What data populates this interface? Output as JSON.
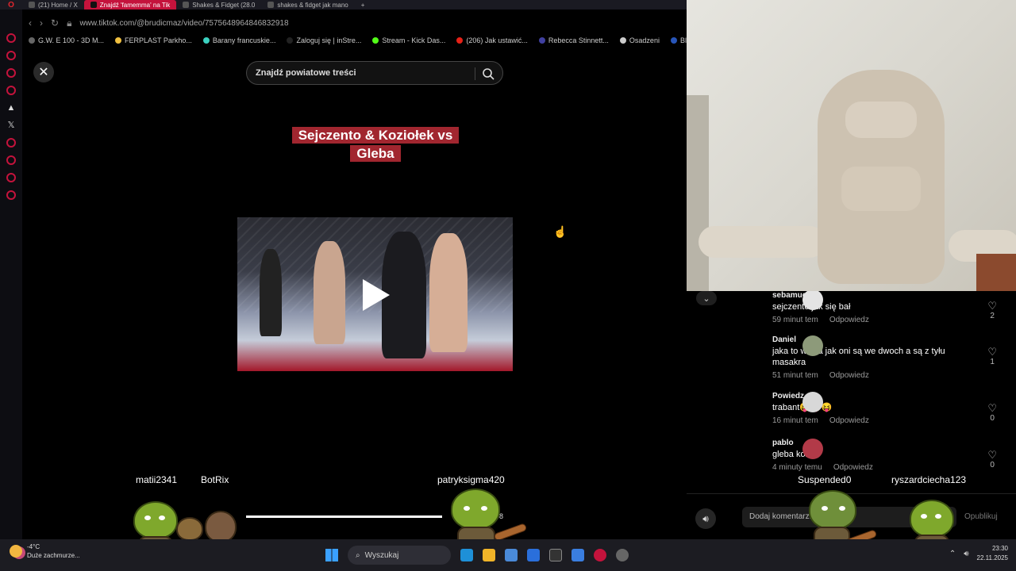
{
  "browser": {
    "tabs": [
      {
        "label": "(21) Home / X",
        "active": false
      },
      {
        "label": "Znajdź 'famemma' na Tik",
        "active": true
      },
      {
        "label": "Shakes & Fidget (28.0",
        "active": false
      },
      {
        "label": "shakes & fidget jak mano",
        "active": false
      }
    ],
    "new_tab": "+",
    "url": "www.tiktok.com/@brudicmaz/video/7575648964846832918",
    "bookmarks": [
      "G.W. E 100 - 3D M...",
      "FERPLAST Parkho...",
      "Barany francuskie...",
      "Zaloguj się | inStre...",
      "Stream - Kick Das...",
      "(206) Jak ustawić...",
      "Rebecca Stinnett...",
      "Osadzeni",
      "Blue Sail"
    ]
  },
  "video": {
    "search_placeholder": "Znajdź powiatowe treści",
    "caption_line1": "Sejczento & Koziołek vs",
    "caption_line2": "Gleba",
    "timecode": "08",
    "progress": 0.76
  },
  "comments": [
    {
      "user": "sebamucha",
      "text": "sejczento jak się bał",
      "time": "59 minut tem",
      "reply": "Odpowiedz",
      "likes": "2",
      "avatar_color": "#e4e4e4"
    },
    {
      "user": "Daniel",
      "text": "jaka to walka jak oni są we dwoch a są z tyłu masakra",
      "time": "51 minut tem",
      "reply": "Odpowiedz",
      "likes": "1",
      "avatar_color": "#8d9a7a"
    },
    {
      "user": "Powiedz",
      "text": "trabant😝😝😝",
      "time": "16 minut tem",
      "reply": "Odpowiedz",
      "likes": "0",
      "avatar_color": "#d8d8d8"
    },
    {
      "user": "pablo",
      "text": "gleba kozak",
      "time": "4 minuty temu",
      "reply": "Odpowiedz",
      "likes": "0",
      "avatar_color": "#b23a48"
    }
  ],
  "comment_bar": {
    "placeholder": "Dodaj komentarz...",
    "publish": "Opublikuj"
  },
  "overlay_names": {
    "n1": "matii2341",
    "n2": "BotRix",
    "n3": "patryksigma420",
    "n4": "Suspended0",
    "n5": "ryszardciecha123"
  },
  "taskbar": {
    "temperature": "-4°C",
    "weather": "Duże zachmurze...",
    "search": "Wyszukaj",
    "time": "23:30",
    "date": "22.11.2025"
  }
}
